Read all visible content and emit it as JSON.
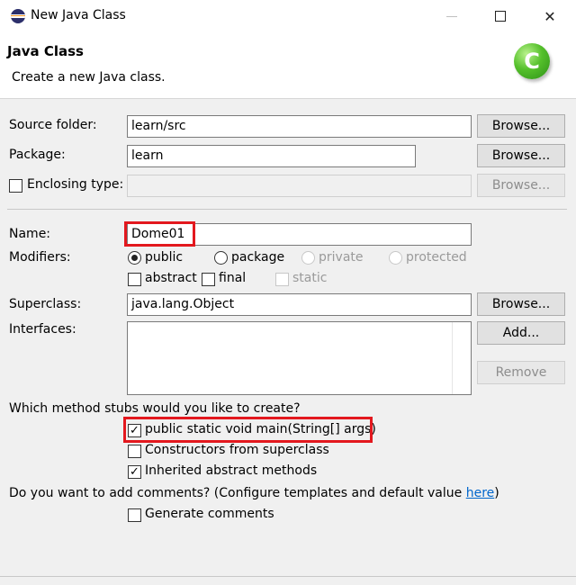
{
  "window": {
    "title": "New Java Class",
    "minimize": "—",
    "close": "✕"
  },
  "banner": {
    "title": "Java Class",
    "description": "Create a new Java class.",
    "icon_letter": "C"
  },
  "form": {
    "source_folder": {
      "label": "Source folder:",
      "value": "learn/src",
      "button": "Browse..."
    },
    "package": {
      "label": "Package:",
      "value": "learn",
      "button": "Browse..."
    },
    "enclosing_type": {
      "label": "Enclosing type:",
      "value": "",
      "button": "Browse...",
      "checked": false
    },
    "name": {
      "label": "Name:",
      "value": "Dome01"
    },
    "modifiers": {
      "label": "Modifiers:",
      "radios": [
        "public",
        "package",
        "private",
        "protected"
      ],
      "selected": "public",
      "checkboxes": [
        "abstract",
        "final",
        "static"
      ]
    },
    "superclass": {
      "label": "Superclass:",
      "value": "java.lang.Object",
      "button": "Browse..."
    },
    "interfaces": {
      "label": "Interfaces:",
      "add_button": "Add...",
      "remove_button": "Remove"
    },
    "stubs": {
      "question": "Which method stubs would you like to create?",
      "main": "public static void main(String[] args)",
      "constructors": "Constructors from superclass",
      "inherited": "Inherited abstract methods",
      "main_checked": true,
      "constructors_checked": false,
      "inherited_checked": true
    },
    "comments": {
      "question": "Do you want to add comments? (Configure templates and default value ",
      "link": "here",
      "suffix": ")",
      "generate": "Generate comments",
      "checked": false
    },
    "check_mark": "✓"
  },
  "colors": {
    "highlight": "#e3181e",
    "link": "#0066cc",
    "icon_green": "#55c02b"
  }
}
